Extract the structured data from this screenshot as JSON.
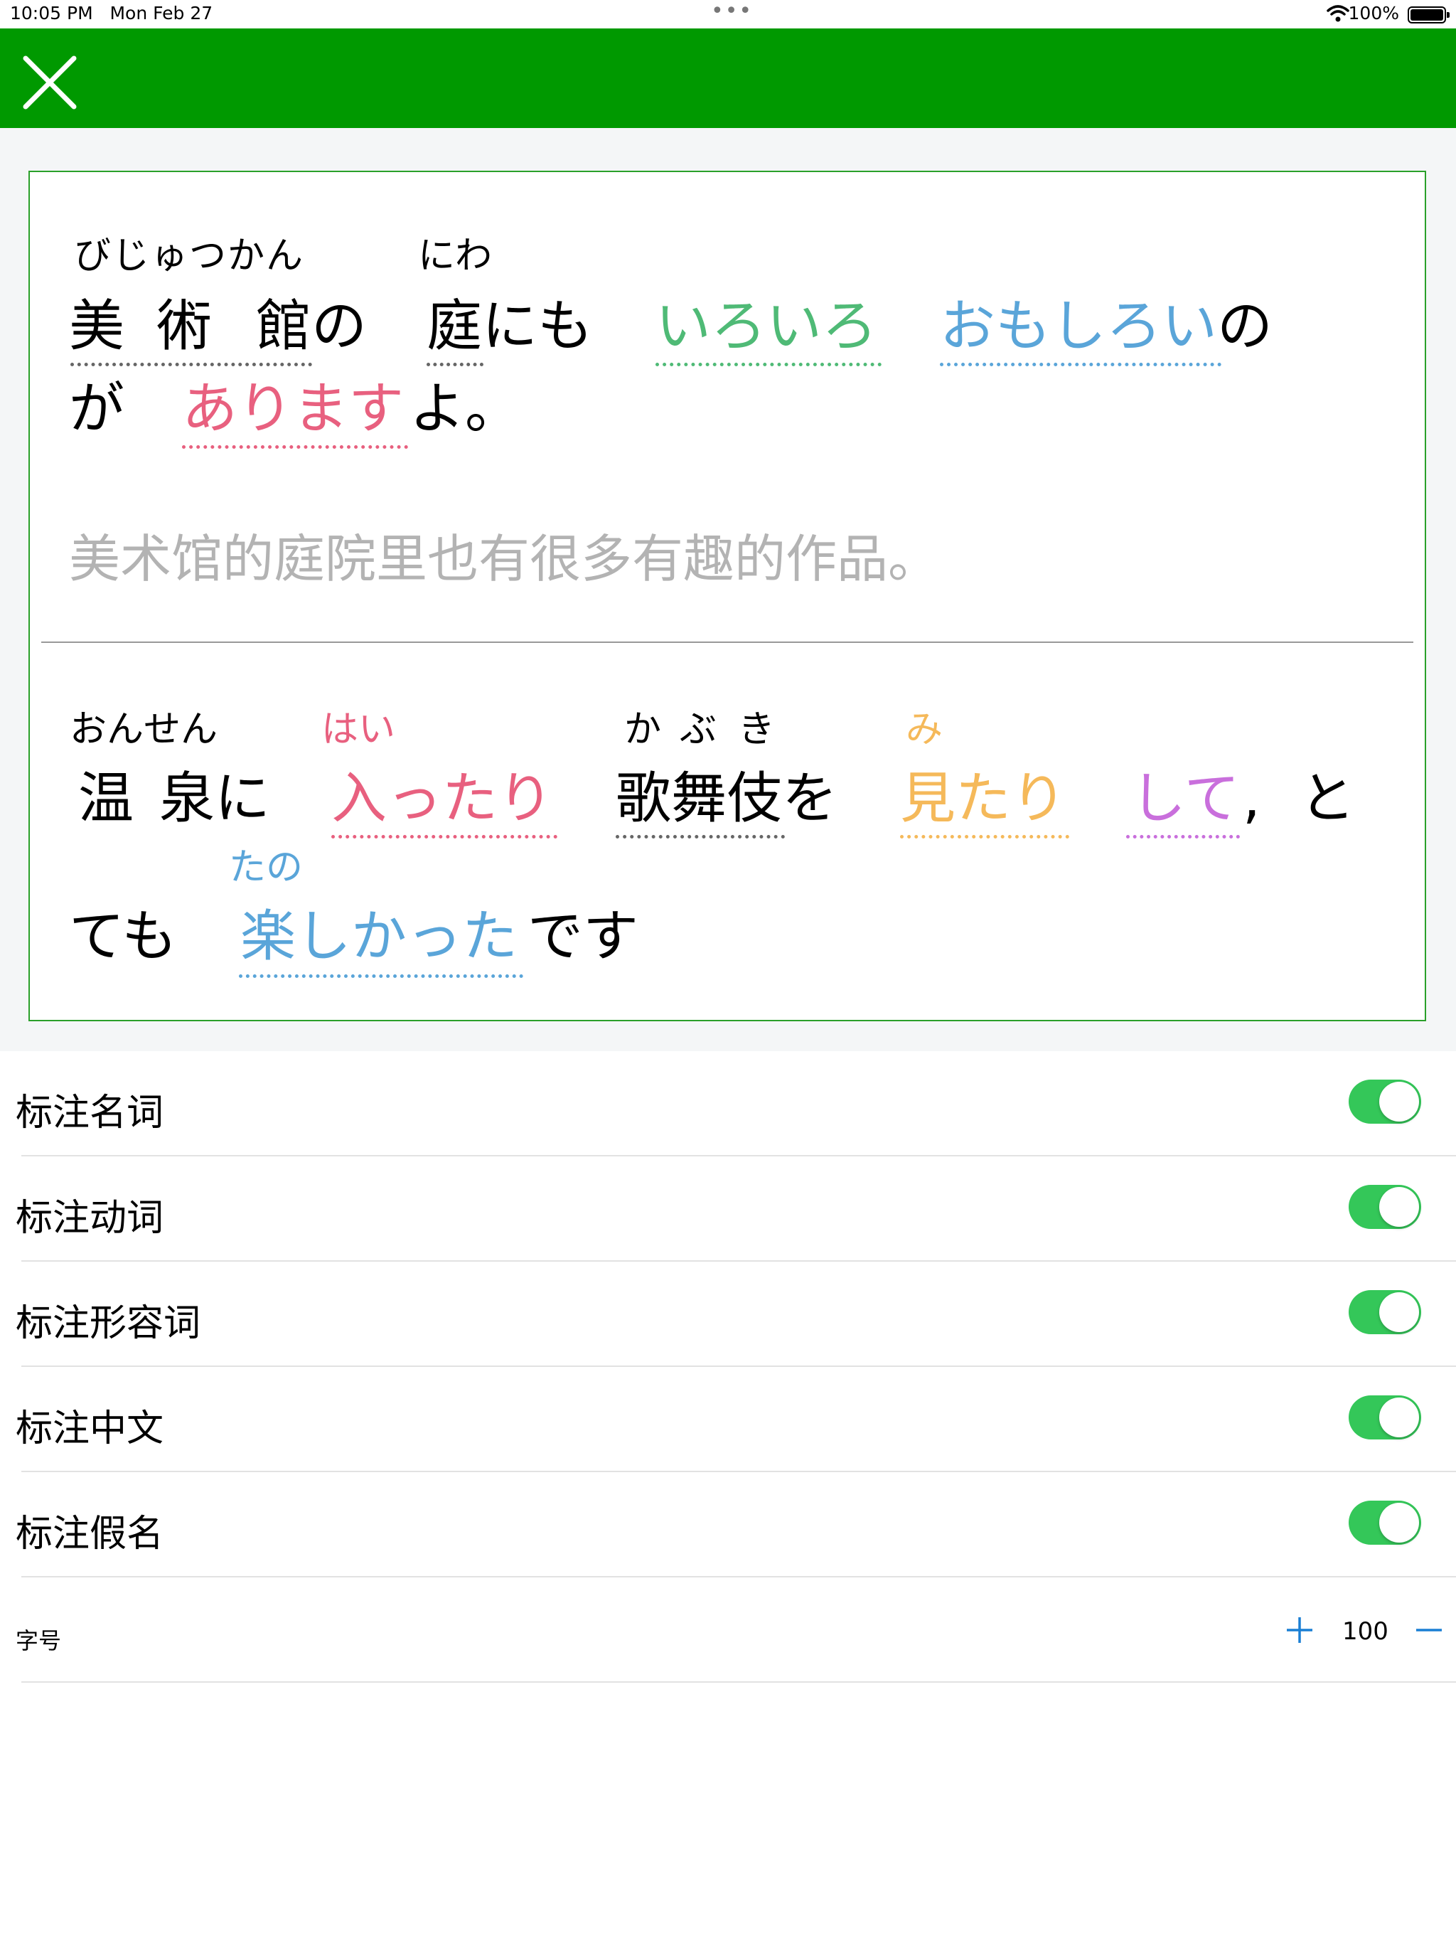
{
  "status_bar": {
    "time": "10:05 PM",
    "date": "Mon Feb 27",
    "dots": "•••",
    "battery": "100%"
  },
  "nav": {
    "close_icon": "close-icon"
  },
  "sentence1": {
    "furigana": {
      "bijutsukan": "びじゅつかん",
      "niwa": "にわ"
    },
    "text": {
      "bi": "美",
      "jutsu": "術",
      "kan": "館",
      "no": "の",
      "niwa": "庭",
      "nimo": "にも",
      "iroiro": "いろいろ",
      "omoshiroi": "おもしろい",
      "no2": "の",
      "ga": "が",
      "arimasu": "あります",
      "yo": "よ。"
    },
    "translation": "美术馆的庭院里也有很多有趣的作品。"
  },
  "sentence2": {
    "furigana": {
      "onsen": "おんせん",
      "hai": "はい",
      "ka": "か",
      "bu": "ぶ",
      "ki": "き",
      "mi": "み",
      "tano": "たの"
    },
    "text": {
      "on": "温",
      "sen": "泉",
      "ni": "に",
      "haittari": "入ったり",
      "kabuki": "歌舞伎",
      "wo": "を",
      "mitari": "見たり",
      "shite": "して",
      "comma": ",",
      "to": "と",
      "temo": "ても",
      "tanoshikatta": "楽しかった",
      "desu": "です"
    }
  },
  "colors": {
    "noun": "#666666",
    "verb": "#e8607f",
    "adjective": "#5aa5d9",
    "adverb": "#4fba76",
    "verb_alt": "#f5b95a",
    "aux": "#c96fdc"
  },
  "settings": [
    {
      "label": "标注名词",
      "on": true
    },
    {
      "label": "标注动词",
      "on": true
    },
    {
      "label": "标注形容词",
      "on": true
    },
    {
      "label": "标注中文",
      "on": true
    },
    {
      "label": "标注假名",
      "on": true
    }
  ],
  "font_size": {
    "label": "字号",
    "value": "100",
    "plus_icon": "plus-icon",
    "minus_icon": "minus-icon"
  }
}
